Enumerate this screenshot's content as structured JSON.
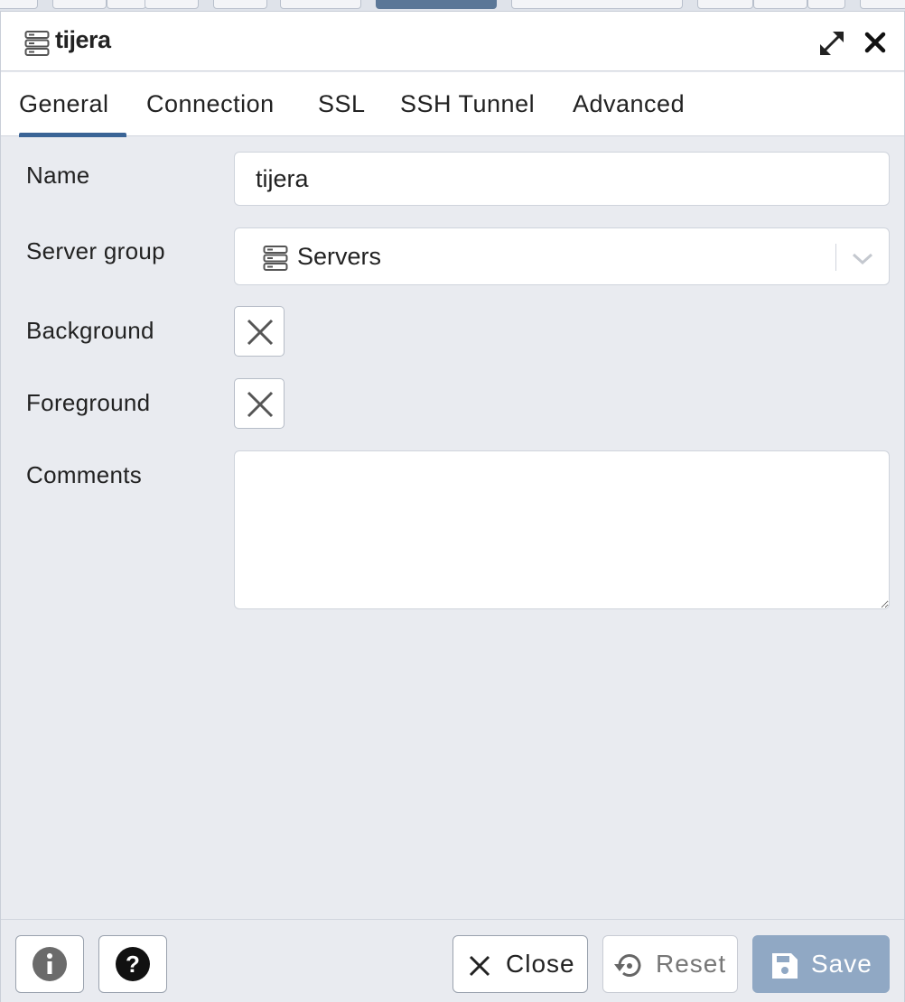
{
  "dialog": {
    "title": "tijera",
    "title_icon": "server-icon",
    "expand_icon": "expand-icon",
    "close_icon": "close-icon"
  },
  "tabs": [
    {
      "label": "General",
      "active": true
    },
    {
      "label": "Connection",
      "active": false
    },
    {
      "label": "SSL",
      "active": false
    },
    {
      "label": "SSH Tunnel",
      "active": false
    },
    {
      "label": "Advanced",
      "active": false
    }
  ],
  "form": {
    "name_label": "Name",
    "name_value": "tijera",
    "server_group_label": "Server group",
    "server_group_value": "Servers",
    "server_group_icon": "server-group-icon",
    "background_label": "Background",
    "foreground_label": "Foreground",
    "comments_label": "Comments",
    "comments_value": ""
  },
  "footer": {
    "info_icon": "info-icon",
    "help_icon": "help-icon",
    "close_label": "Close",
    "reset_label": "Reset",
    "save_label": "Save"
  },
  "colors": {
    "accent": "#3a6496",
    "save_button": "#90a8c4",
    "background": "#e9ebf0"
  }
}
